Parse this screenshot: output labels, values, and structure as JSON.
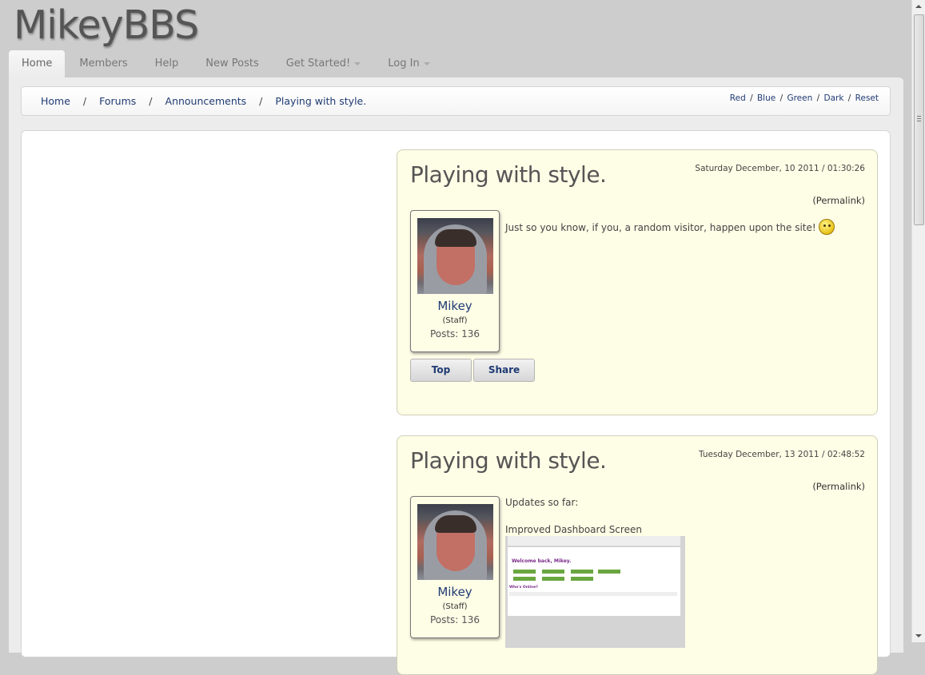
{
  "site": {
    "title": "MikeyBBS"
  },
  "nav": {
    "tabs": [
      {
        "label": "Home"
      },
      {
        "label": "Members"
      },
      {
        "label": "Help"
      },
      {
        "label": "New Posts"
      },
      {
        "label": "Get Started!"
      },
      {
        "label": "Log In"
      }
    ]
  },
  "breadcrumb": {
    "items": [
      "Home",
      "Forums",
      "Announcements",
      "Playing with style."
    ],
    "separator": "/"
  },
  "style_switcher": {
    "items": [
      "Red",
      "Blue",
      "Green",
      "Dark",
      "Reset"
    ],
    "separator": "/"
  },
  "posts": [
    {
      "title": "Playing with style.",
      "date": "Saturday December, 10 2011 / 01:30:26",
      "permalink": "(Permalink)",
      "author": {
        "name": "Mikey",
        "role": "(Staff)",
        "posts": "Posts: 136"
      },
      "body": "Just so you know, if you, a random visitor, happen upon the site!",
      "buttons": {
        "top": "Top",
        "share": "Share"
      }
    },
    {
      "title": "Playing with style.",
      "date": "Tuesday December, 13 2011 / 02:48:52",
      "permalink": "(Permalink)",
      "author": {
        "name": "Mikey",
        "role": "(Staff)",
        "posts": "Posts: 136"
      },
      "body_line1": "Updates so far:",
      "body_line2": "Improved Dashboard Screen",
      "thumb_welcome": "Welcome back, Mikey.",
      "thumb_who": "Who's Online?"
    }
  ],
  "colors": {
    "link": "#1f3b73",
    "post_bg": "#fefde6",
    "page_bg": "#cdcdcd"
  }
}
